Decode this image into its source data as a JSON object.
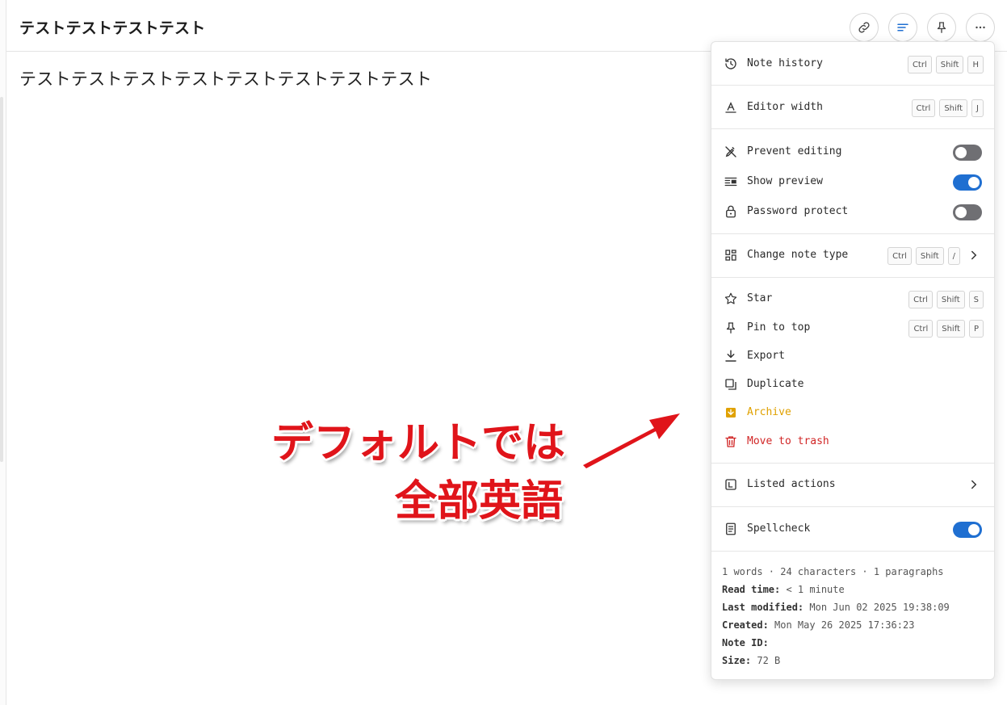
{
  "note": {
    "title": "テストテストテストテスト",
    "body": "テストテストテストテストテストテストテストテスト"
  },
  "toolbar": {
    "buttons": [
      {
        "icon": "link-icon"
      },
      {
        "icon": "text-lines-icon",
        "color": "#1f6fd1"
      },
      {
        "icon": "pin-icon"
      },
      {
        "icon": "more-icon"
      }
    ]
  },
  "menu": {
    "note_history": {
      "label": "Note history",
      "keys": [
        "Ctrl",
        "Shift",
        "H"
      ]
    },
    "editor_width": {
      "label": "Editor width",
      "keys": [
        "Ctrl",
        "Shift",
        "J"
      ]
    },
    "prevent_editing": {
      "label": "Prevent editing",
      "on": false
    },
    "show_preview": {
      "label": "Show preview",
      "on": true
    },
    "password_protect": {
      "label": "Password protect",
      "on": false
    },
    "change_note_type": {
      "label": "Change note type",
      "keys": [
        "Ctrl",
        "Shift",
        "/"
      ]
    },
    "star": {
      "label": "Star",
      "keys": [
        "Ctrl",
        "Shift",
        "S"
      ]
    },
    "pin_to_top": {
      "label": "Pin to top",
      "keys": [
        "Ctrl",
        "Shift",
        "P"
      ]
    },
    "export": {
      "label": "Export"
    },
    "duplicate": {
      "label": "Duplicate"
    },
    "archive": {
      "label": "Archive",
      "color": "#e0a100"
    },
    "move_to_trash": {
      "label": "Move to trash",
      "color": "#d12626"
    },
    "listed_actions": {
      "label": "Listed actions"
    },
    "spellcheck": {
      "label": "Spellcheck",
      "on": true
    }
  },
  "info": {
    "stats": "1 words · 24 characters · 1 paragraphs",
    "read_time_label": "Read time:",
    "read_time": "< 1 minute",
    "last_modified_label": "Last modified:",
    "last_modified": "Mon Jun 02 2025 19:38:09",
    "created_label": "Created:",
    "created": "Mon May 26 2025 17:36:23",
    "note_id_label": "Note ID:",
    "size_label": "Size:",
    "size": "72 B"
  },
  "annotation": {
    "line1": "デフォルトでは",
    "line2": "全部英語",
    "color": "#e0141a"
  }
}
